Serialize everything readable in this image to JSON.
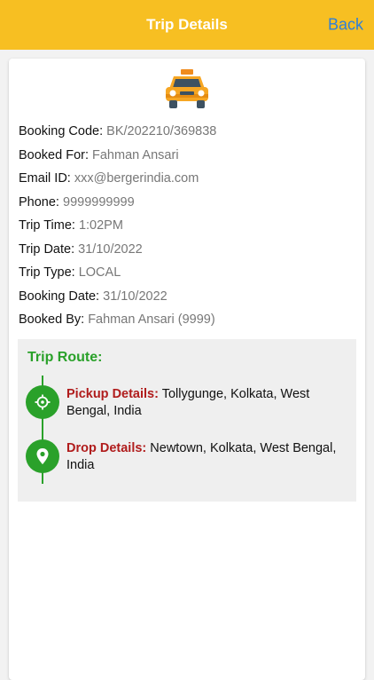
{
  "header": {
    "title": "Trip Details",
    "back_label": "Back"
  },
  "colors": {
    "header_bg": "#f7bf22",
    "back_text": "#2f7fd8",
    "route_green": "#2aa12a",
    "route_label_red": "#b01c1c"
  },
  "details": [
    {
      "label": "Booking Code: ",
      "value": "BK/202210/369838"
    },
    {
      "label": "Booked For: ",
      "value": "Fahman Ansari"
    },
    {
      "label": "Email ID: ",
      "value": "xxx@bergerindia.com"
    },
    {
      "label": "Phone: ",
      "value": "9999999999"
    },
    {
      "label": "Trip Time: ",
      "value": "1:02PM"
    },
    {
      "label": "Trip Date: ",
      "value": "31/10/2022"
    },
    {
      "label": "Trip Type: ",
      "value": "LOCAL"
    },
    {
      "label": "Booking Date: ",
      "value": "31/10/2022"
    },
    {
      "label": "Booked By: ",
      "value": "Fahman Ansari (9999)"
    }
  ],
  "route": {
    "title": "Trip Route:",
    "pickup": {
      "label": "Pickup Details:",
      "value": " Tollygunge, Kolkata, West Bengal, India",
      "icon": "crosshair-icon"
    },
    "drop": {
      "label": "Drop Details:",
      "value": " Newtown, Kolkata, West Bengal, India",
      "icon": "map-pin-icon"
    }
  }
}
